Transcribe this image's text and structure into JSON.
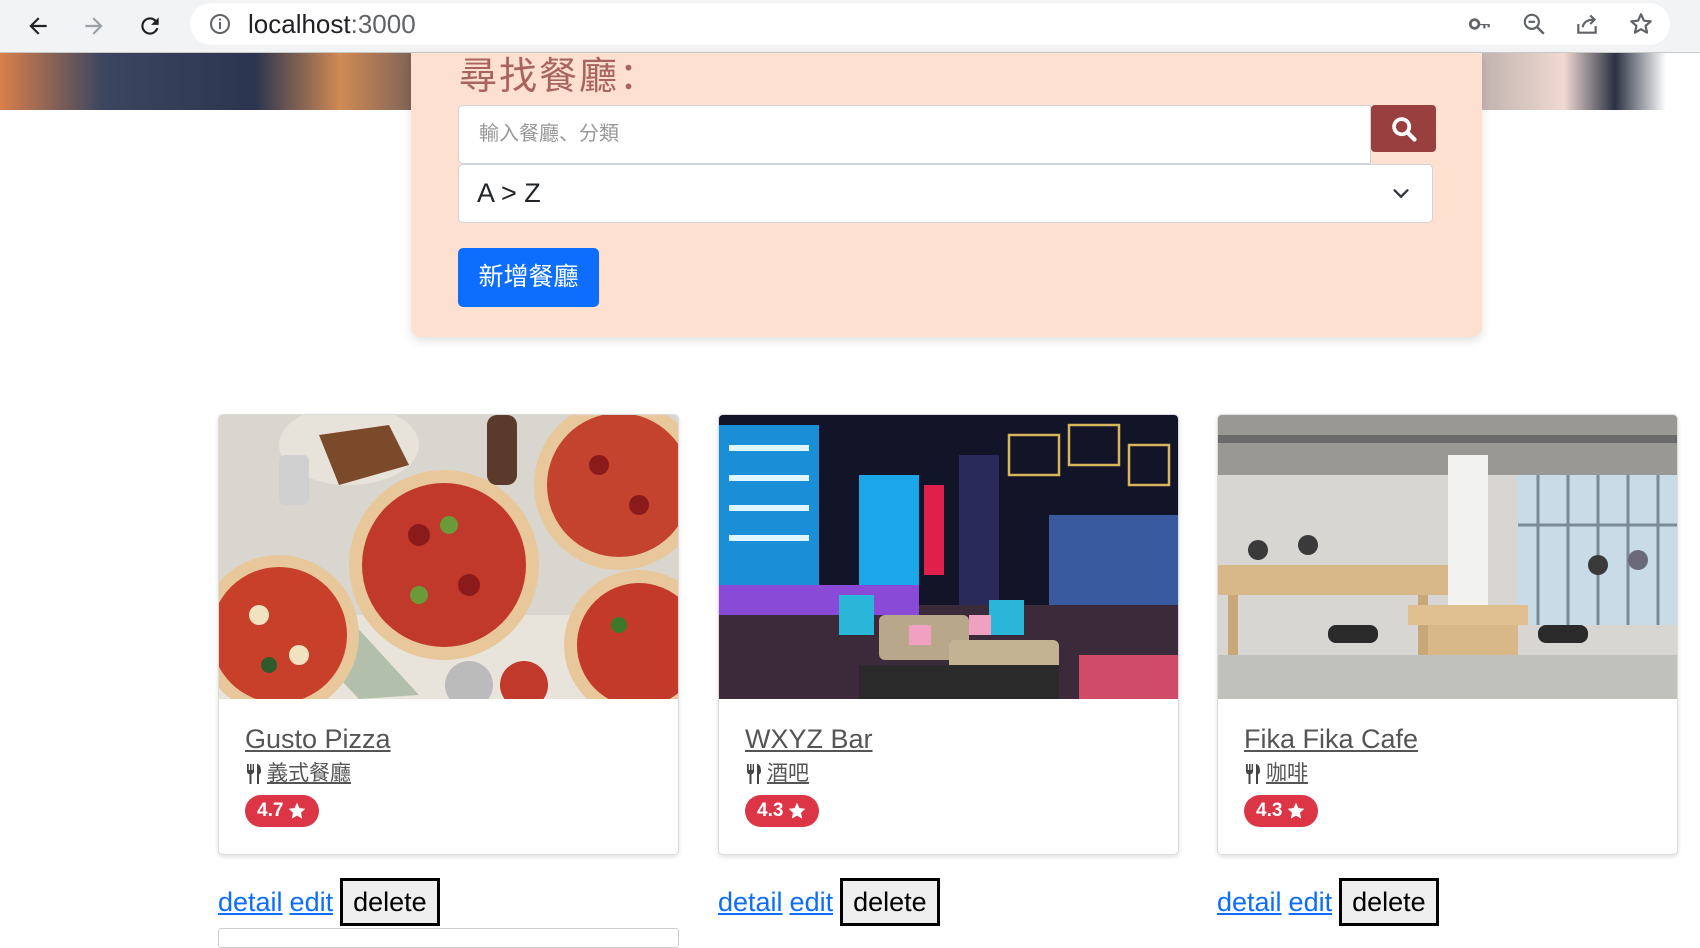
{
  "browser": {
    "url_host": "localhost",
    "url_port": ":3000"
  },
  "search_panel": {
    "title": "尋找餐廳：",
    "search_placeholder": "輸入餐廳、分類",
    "sort_value": "A > Z",
    "add_button_label": "新增餐廳"
  },
  "restaurants": [
    {
      "name": "Gusto Pizza",
      "category": "義式餐廳",
      "rating": "4.7",
      "actions": {
        "detail": "detail",
        "edit": "edit",
        "delete": "delete"
      }
    },
    {
      "name": "WXYZ Bar",
      "category": "酒吧",
      "rating": "4.3",
      "actions": {
        "detail": "detail",
        "edit": "edit",
        "delete": "delete"
      }
    },
    {
      "name": "Fika Fika Cafe",
      "category": "咖啡",
      "rating": "4.3",
      "actions": {
        "detail": "detail",
        "edit": "edit",
        "delete": "delete"
      }
    }
  ],
  "colors": {
    "panel_bg": "#fde0d0",
    "search_button": "#9a3f3f",
    "add_button": "#0d6efd",
    "rating_badge": "#dc3545"
  }
}
